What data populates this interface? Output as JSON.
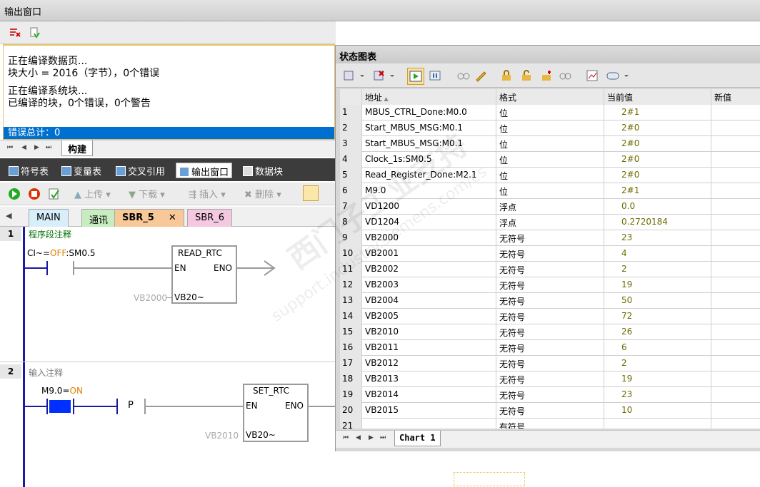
{
  "output_window": {
    "title": "输出窗口",
    "lines": [
      "正在编译数据页...",
      "块大小 = 2016（字节），0个错误",
      "",
      "正在编译系统块...",
      "已编译的块，0个错误，0个警告"
    ],
    "error_line": "错误总计：0",
    "build_tab": "构建"
  },
  "dock_tabs": [
    {
      "label": "符号表"
    },
    {
      "label": "变量表"
    },
    {
      "label": "交叉引用"
    },
    {
      "label": "输出窗口"
    },
    {
      "label": "数据块"
    }
  ],
  "prog_toolbar": {
    "upload": "上传",
    "download": "下载",
    "insert": "插入",
    "delete": "删除"
  },
  "prog_tabs": [
    {
      "label": "MAIN",
      "color": "#d8eefa"
    },
    {
      "label": "通讯",
      "color": "#c6ecc0"
    },
    {
      "label": "SBR_5",
      "color": "#f8c898"
    },
    {
      "label": "SBR_6",
      "color": "#f4c8e0"
    }
  ],
  "networks": [
    {
      "num": "1",
      "comment": "程序段注释",
      "contact": {
        "pre": "CI~=",
        "state": "OFF",
        "post": ":SM0.5"
      },
      "box": {
        "title": "READ_RTC",
        "en": "EN",
        "eno": "ENO",
        "param": "VB20~",
        "operand": "VB2000"
      }
    },
    {
      "num": "2",
      "comment": "输入注释",
      "contact": {
        "pre": "M9.0=",
        "state": "ON",
        "post": ""
      },
      "p": "P",
      "box": {
        "title": "SET_RTC",
        "en": "EN",
        "eno": "ENO",
        "param": "VB20~",
        "operand": "VB2010"
      }
    }
  ],
  "status_chart": {
    "title": "状态图表",
    "headers": {
      "addr": "地址",
      "fmt": "格式",
      "val": "当前值",
      "new": "新值"
    },
    "rows": [
      {
        "n": "1",
        "addr": "MBUS_CTRL_Done:M0.0",
        "fmt": "位",
        "val": "2#1"
      },
      {
        "n": "2",
        "addr": "Start_MBUS_MSG:M0.1",
        "fmt": "位",
        "val": "2#0"
      },
      {
        "n": "3",
        "addr": "Start_MBUS_MSG:M0.1",
        "fmt": "位",
        "val": "2#0"
      },
      {
        "n": "4",
        "addr": "Clock_1s:SM0.5",
        "fmt": "位",
        "val": "2#0"
      },
      {
        "n": "5",
        "addr": "Read_Register_Done:M2.1",
        "fmt": "位",
        "val": "2#0"
      },
      {
        "n": "6",
        "addr": "M9.0",
        "fmt": "位",
        "val": "2#1"
      },
      {
        "n": "7",
        "addr": "VD1200",
        "fmt": "浮点",
        "val": "0.0"
      },
      {
        "n": "8",
        "addr": "VD1204",
        "fmt": "浮点",
        "val": "0.2720184"
      },
      {
        "n": "9",
        "addr": "VB2000",
        "fmt": "无符号",
        "val": "23"
      },
      {
        "n": "10",
        "addr": "VB2001",
        "fmt": "无符号",
        "val": "4"
      },
      {
        "n": "11",
        "addr": "VB2002",
        "fmt": "无符号",
        "val": "2"
      },
      {
        "n": "12",
        "addr": "VB2003",
        "fmt": "无符号",
        "val": "19"
      },
      {
        "n": "13",
        "addr": "VB2004",
        "fmt": "无符号",
        "val": "50"
      },
      {
        "n": "14",
        "addr": "VB2005",
        "fmt": "无符号",
        "val": "72"
      },
      {
        "n": "15",
        "addr": "VB2010",
        "fmt": "无符号",
        "val": "26"
      },
      {
        "n": "16",
        "addr": "VB2011",
        "fmt": "无符号",
        "val": "6"
      },
      {
        "n": "17",
        "addr": "VB2012",
        "fmt": "无符号",
        "val": "2"
      },
      {
        "n": "18",
        "addr": "VB2013",
        "fmt": "无符号",
        "val": "19"
      },
      {
        "n": "19",
        "addr": "VB2014",
        "fmt": "无符号",
        "val": "23"
      },
      {
        "n": "20",
        "addr": "VB2015",
        "fmt": "无符号",
        "val": "10"
      },
      {
        "n": "21",
        "addr": "",
        "fmt": "有符号",
        "val": ""
      }
    ],
    "sheet_tab": "Chart 1"
  },
  "watermark": {
    "cn": "西门子工业支持",
    "url": "support.industry.siemens.com/cs"
  }
}
